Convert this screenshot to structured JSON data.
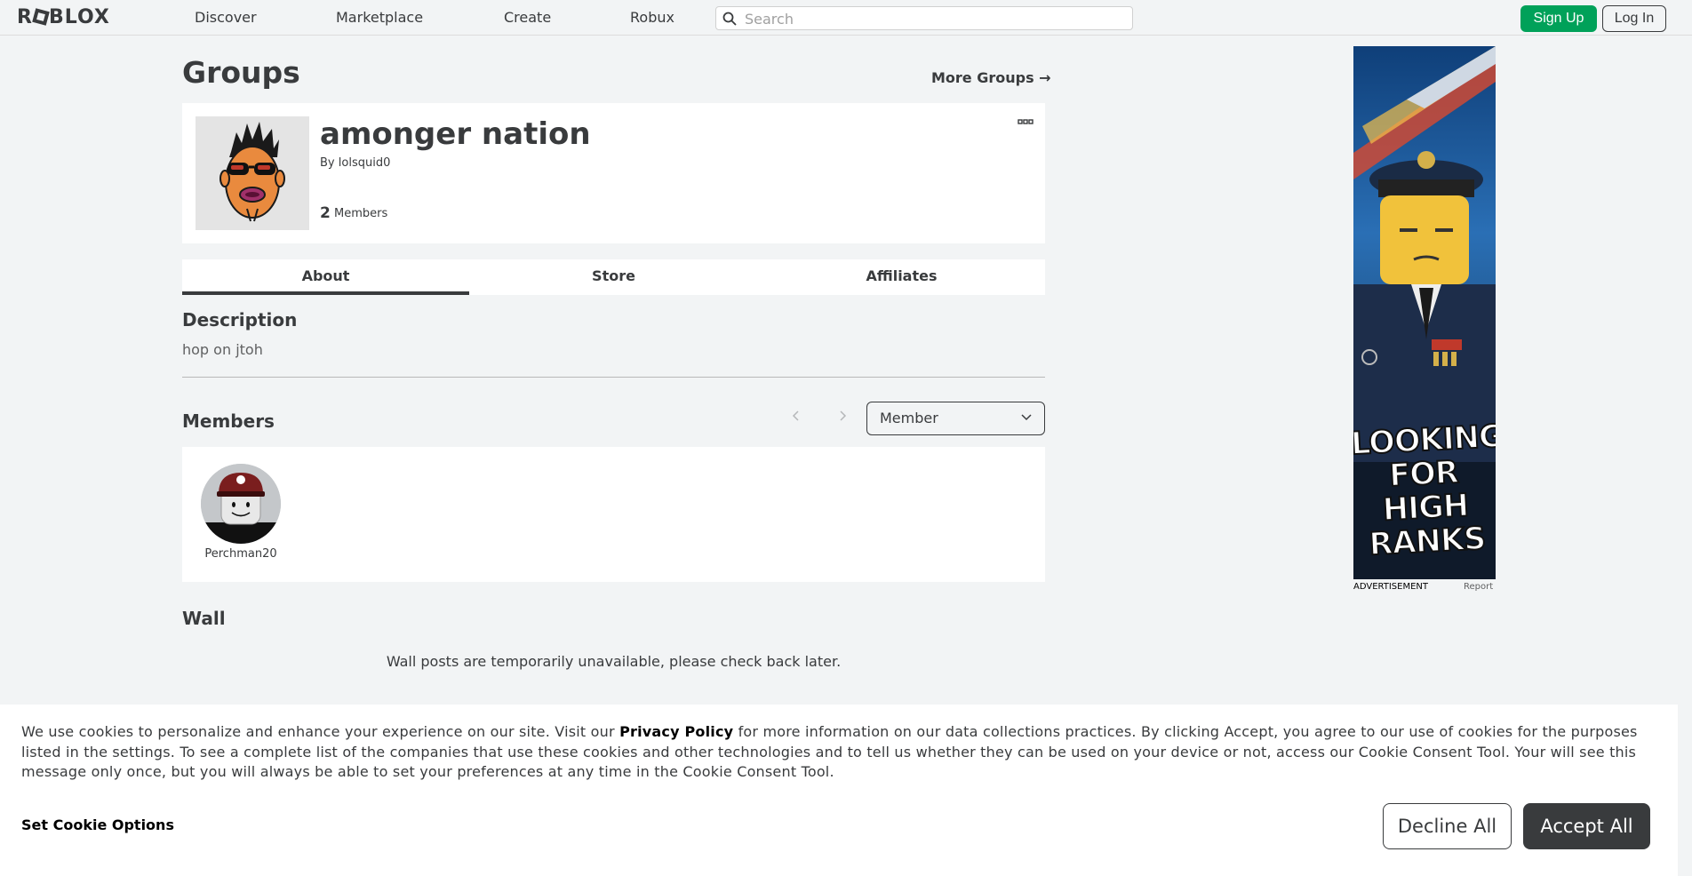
{
  "nav": {
    "logo": "ROBLOX",
    "links": [
      "Discover",
      "Marketplace",
      "Create",
      "Robux"
    ],
    "search_placeholder": "Search",
    "signup": "Sign Up",
    "login": "Log In"
  },
  "header": {
    "title": "Groups",
    "more_groups": "More Groups →"
  },
  "group": {
    "name": "amonger nation",
    "by_label": "By",
    "owner": "lolsquid0",
    "member_count": "2",
    "member_label": "Members"
  },
  "tabs": [
    "About",
    "Store",
    "Affiliates"
  ],
  "description": {
    "title": "Description",
    "text": "hop on jtoh"
  },
  "members": {
    "title": "Members",
    "role_selected": "Member",
    "list": [
      {
        "name": "Perchman20"
      }
    ]
  },
  "wall": {
    "title": "Wall",
    "message": "Wall posts are temporarily unavailable, please check back later."
  },
  "ad": {
    "headline_lines": [
      "LOOKING",
      "FOR HIGH",
      "RANKS"
    ],
    "label": "ADVERTISEMENT",
    "report": "Report"
  },
  "cookie": {
    "text_before": "We use cookies to personalize and enhance your experience on our site. Visit our ",
    "privacy_link": "Privacy Policy",
    "text_after": " for more information on our data collections practices. By clicking Accept, you agree to our use of cookies for the purposes listed in the settings. To see a complete list of the companies that use these cookies and other technologies and to tell us whether they can be used on your device or not, access our Cookie Consent Tool. Your will see this message only once, but you will always be able to set your preferences at any time in the Cookie Consent Tool.",
    "options": "Set Cookie Options",
    "decline": "Decline All",
    "accept": "Accept All"
  },
  "colors": {
    "signup_green": "#00a159",
    "text_dark": "#393b3d",
    "page_bg": "#f2f4f5"
  }
}
